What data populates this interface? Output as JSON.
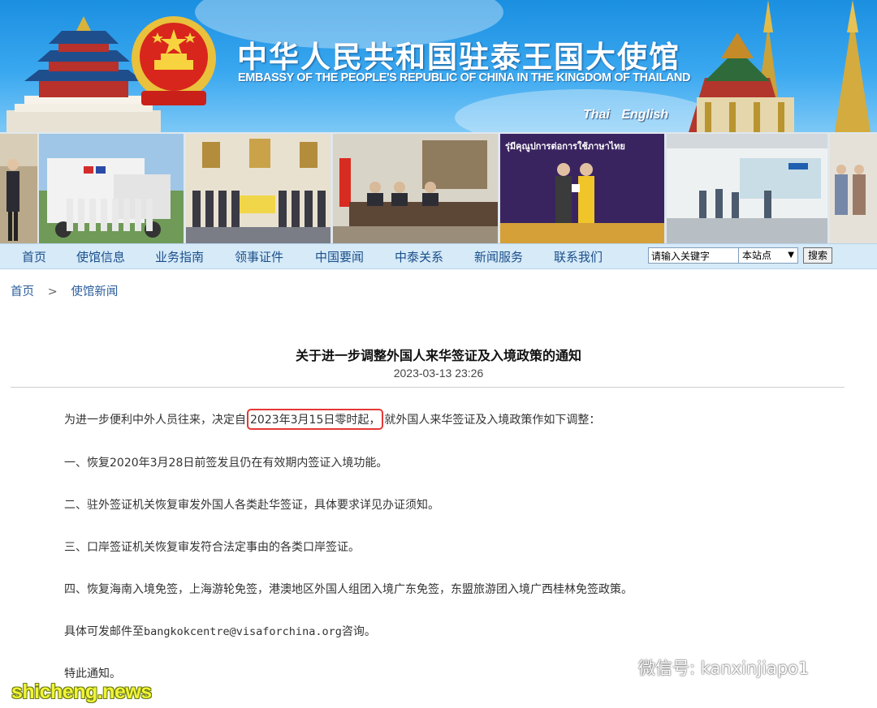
{
  "header": {
    "title": "中华人民共和国驻泰王国大使馆",
    "subtitle": "EMBASSY OF THE PEOPLE'S REPUBLIC OF CHINA IN THE KINGDOM OF THAILAND",
    "languages": [
      "Thai",
      "English"
    ]
  },
  "photo_strip": {
    "banner_text": "รุ่มีคุณูปการต่อการใช้ภาษาไทย"
  },
  "nav": {
    "items": [
      "首页",
      "使馆信息",
      "业务指南",
      "领事证件",
      "中国要闻",
      "中泰关系",
      "新闻服务",
      "联系我们"
    ],
    "search_value": "请输入关键字",
    "scope_value": "本站点",
    "search_button": "搜索"
  },
  "breadcrumb": {
    "home": "首页",
    "separator": ">",
    "current": "使馆新闻"
  },
  "article": {
    "title": "关于进一步调整外国人来华签证及入境政策的通知",
    "date": "2023-03-13 23:26",
    "intro_before": "为进一步便利中外人员往来，决定自",
    "intro_highlight": "2023年3月15日零时起，",
    "intro_after": "就外国人来华签证及入境政策作如下调整：",
    "items": [
      "一、恢复2020年3月28日前签发且仍在有效期内签证入境功能。",
      "二、驻外签证机关恢复审发外国人各类赴华签证，具体要求详见办证须知。",
      "三、口岸签证机关恢复审发符合法定事由的各类口岸签证。",
      "四、恢复海南入境免签，上海游轮免签，港澳地区外国人组团入境广东免签，东盟旅游团入境广西桂林免签政策。"
    ],
    "contact_before": "具体可发邮件至",
    "contact_email": "bangkokcentre@visaforchina.org",
    "contact_after": "咨询。",
    "closing": "特此通知。"
  },
  "watermarks": {
    "wechat": "微信号: kanxinjiapo1",
    "site": "shicheng.news"
  },
  "colors": {
    "banner_blue": "#1b8fe0",
    "nav_bg": "#d6eaf8",
    "link_blue": "#2a5d9b",
    "highlight_red": "#e53935"
  }
}
